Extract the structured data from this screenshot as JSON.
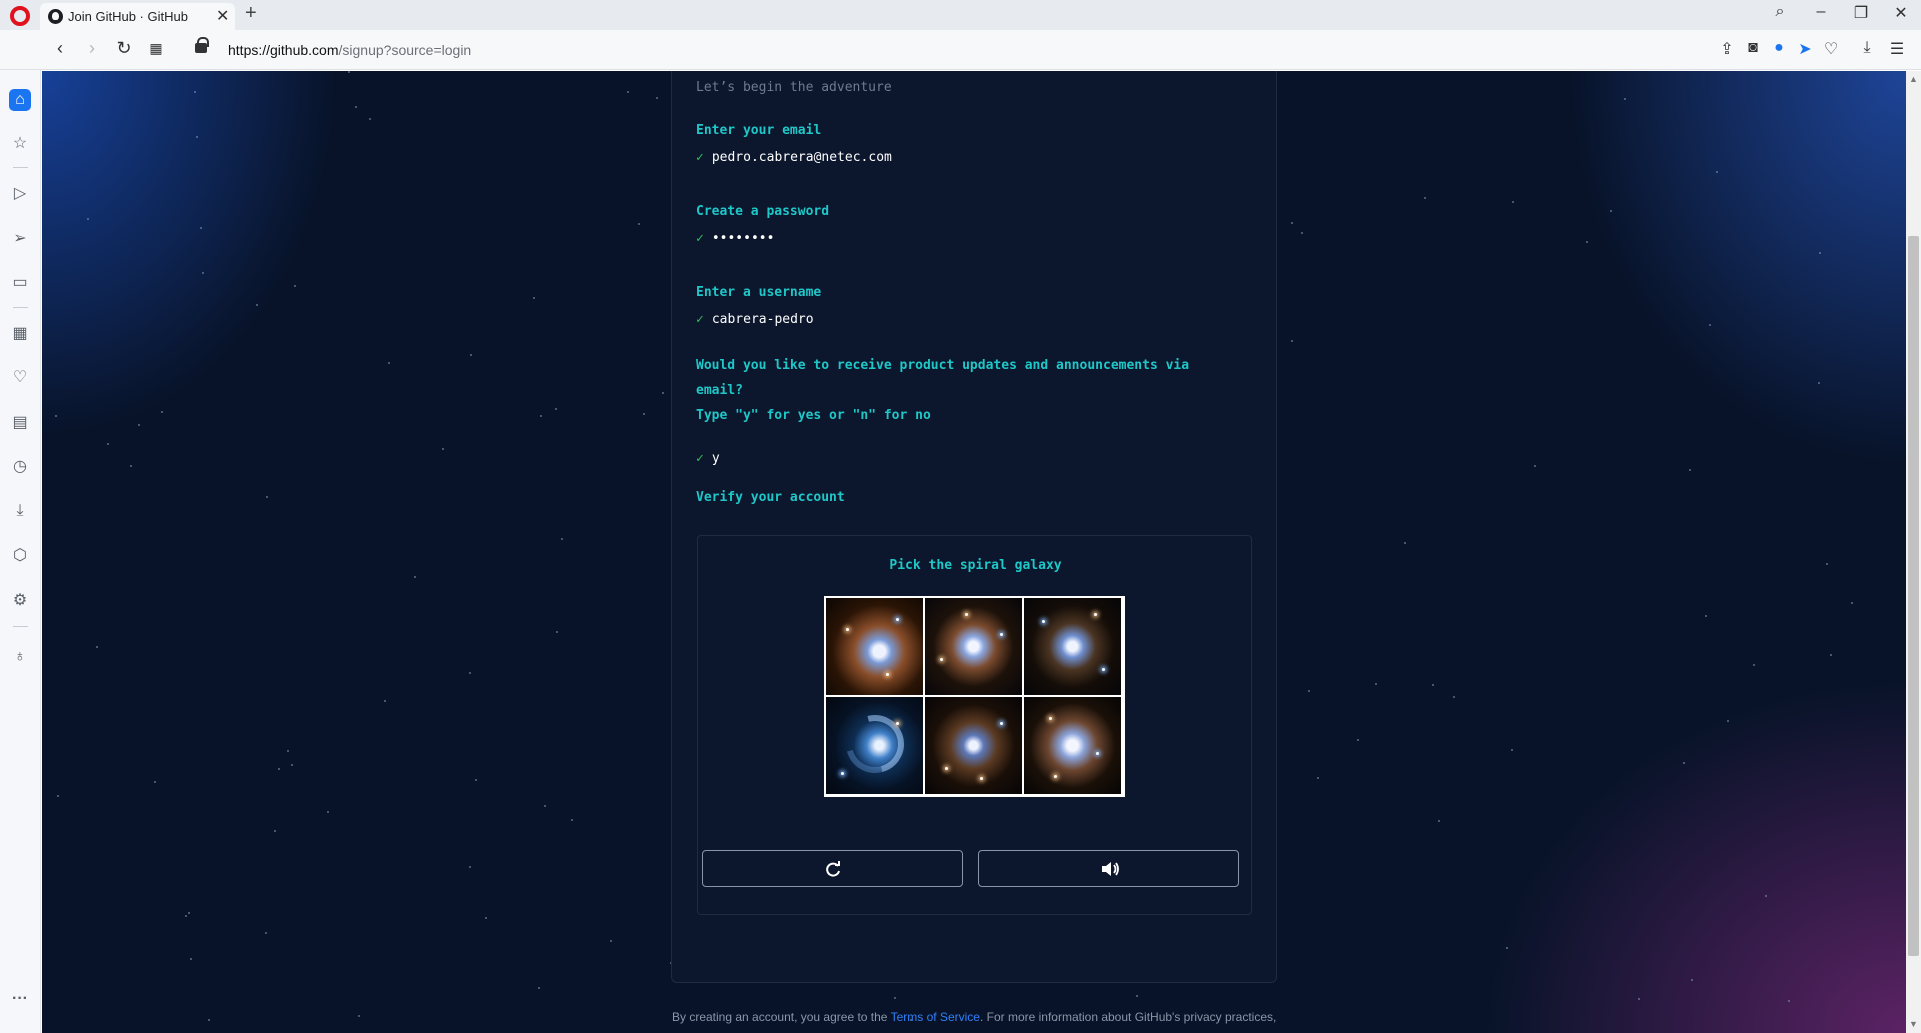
{
  "browser": {
    "tab_title": "Join GitHub · GitHub",
    "new_tab": "+",
    "tab_close": "✕",
    "url_host": "https://github.com",
    "url_path": "/signup?source=login"
  },
  "form": {
    "intro": "Let’s begin the adventure",
    "email_label": "Enter your email",
    "email_value": "pedro.cabrera@netec.com",
    "password_label": "Create a password",
    "password_value": "••••••••",
    "username_label": "Enter a username",
    "username_value": "cabrera-pedro",
    "updates_question_line1": "Would you like to receive product updates and announcements via",
    "updates_question_line2": "email?",
    "updates_hint": "Type \"y\" for yes or \"n\" for no",
    "updates_value": "y",
    "verify_label": "Verify your account",
    "check_mark": "✓"
  },
  "captcha": {
    "prompt": "Pick the spiral galaxy",
    "images": [
      "galaxy-1",
      "galaxy-2",
      "galaxy-3",
      "galaxy-4",
      "galaxy-5",
      "galaxy-6"
    ],
    "refresh_icon": "refresh-icon",
    "audio_icon": "speaker-icon"
  },
  "footer": {
    "text_before": "By creating an account, you agree to the ",
    "terms_link": "Terms of Service",
    "text_after": ". For more information about GitHub's privacy practices,"
  },
  "colors": {
    "accent_teal": "#1fc8c8",
    "check_green": "#2fbf5a",
    "page_bg": "#081329",
    "link_blue": "#2f81f7"
  }
}
